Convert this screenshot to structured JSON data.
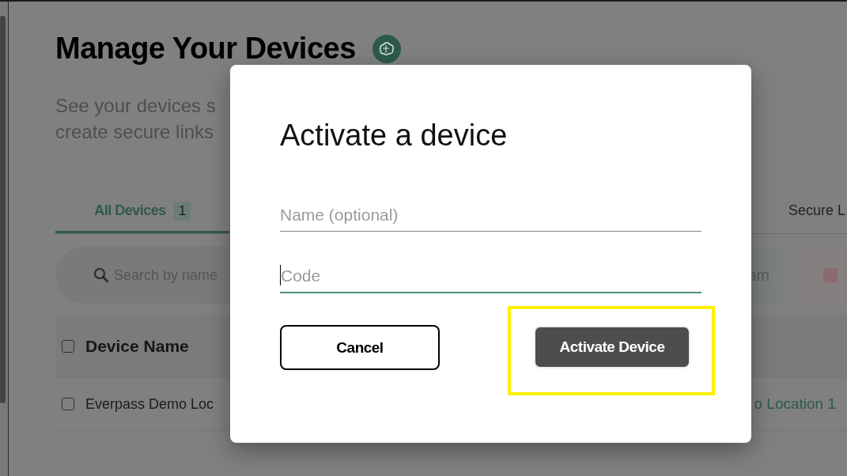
{
  "page": {
    "title": "Manage Your Devices",
    "subtitle_lines": [
      "See your devices s",
      "create secure links"
    ]
  },
  "tabs": [
    {
      "label": "All Devices",
      "count": "1",
      "selected": true
    },
    {
      "label": "Secure L",
      "selected": false
    }
  ],
  "search": {
    "placeholder": "Search by name"
  },
  "filter": {
    "value": "am"
  },
  "table": {
    "header": {
      "label": "Device Name",
      "checked": false
    },
    "rows": [
      {
        "name": "Everpass Demo Loc",
        "checked": false,
        "location": "o Location 1"
      }
    ]
  },
  "dialog": {
    "title": "Activate a device",
    "fields": [
      {
        "placeholder": "Name (optional)",
        "focused": false
      },
      {
        "placeholder": "Code",
        "focused": true
      }
    ],
    "buttons": [
      {
        "label": "Cancel",
        "kind": "secondary",
        "highlighted": false
      },
      {
        "label": "Activate Device",
        "kind": "primary",
        "highlighted": true
      }
    ]
  }
}
